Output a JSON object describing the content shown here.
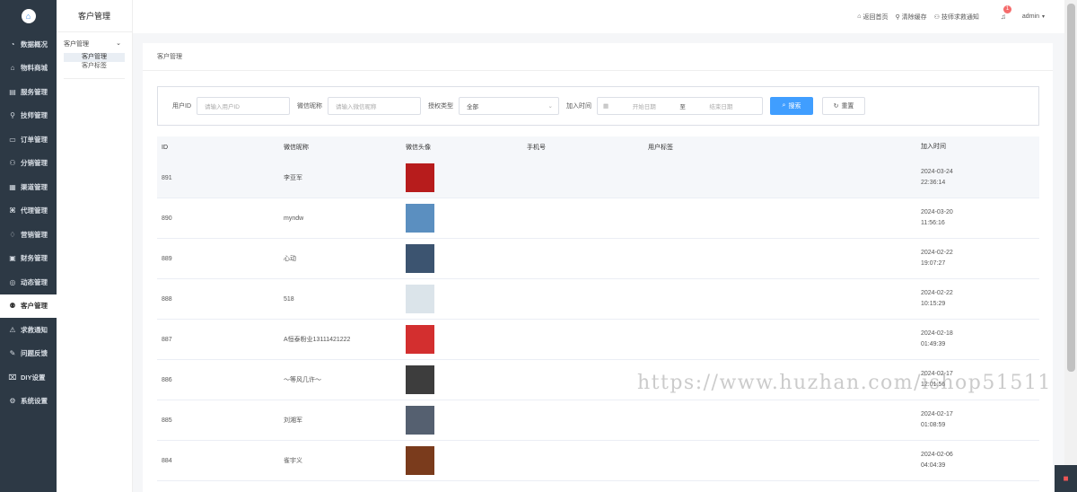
{
  "sidebar": {
    "logo_icon": "house-icon",
    "items": [
      {
        "label": "数据概况",
        "icon": "◔"
      },
      {
        "label": "物料商城",
        "icon": "⌂"
      },
      {
        "label": "服务管理",
        "icon": "▤"
      },
      {
        "label": "技师管理",
        "icon": "⚲"
      },
      {
        "label": "订单管理",
        "icon": "▭"
      },
      {
        "label": "分销管理",
        "icon": "⚇"
      },
      {
        "label": "渠道管理",
        "icon": "▦"
      },
      {
        "label": "代理管理",
        "icon": "⌘"
      },
      {
        "label": "营销管理",
        "icon": "♢"
      },
      {
        "label": "财务管理",
        "icon": "▣"
      },
      {
        "label": "动态管理",
        "icon": "◎"
      },
      {
        "label": "客户管理",
        "icon": "⚉"
      },
      {
        "label": "求救通知",
        "icon": "⚠"
      },
      {
        "label": "问题反馈",
        "icon": "✎"
      },
      {
        "label": "DIY设置",
        "icon": "⌧"
      },
      {
        "label": "系统设置",
        "icon": "⚙"
      }
    ]
  },
  "subnav": {
    "title": "客户管理",
    "group": "客户管理",
    "items": [
      "客户管理",
      "客户标签"
    ]
  },
  "topbar": {
    "home": "返回首页",
    "clear": "清除缓存",
    "alert": "技师求救通知",
    "badge": "1",
    "user": "admin"
  },
  "breadcrumb": "客户管理",
  "filters": {
    "user_id_label": "用户ID",
    "user_id_placeholder": "请输入用户ID",
    "nick_label": "微信昵称",
    "nick_placeholder": "请输入微信昵称",
    "auth_label": "授权类型",
    "auth_value": "全部",
    "join_label": "加入时间",
    "start_placeholder": "开始日期",
    "range_sep": "至",
    "end_placeholder": "结束日期",
    "search": "搜索",
    "reset": "重置"
  },
  "table": {
    "headers": [
      "ID",
      "微信昵称",
      "微信头像",
      "手机号",
      "用户标签",
      "加入时间"
    ],
    "rows": [
      {
        "id": "891",
        "nick": "李亚军",
        "date": "2024-03-24",
        "time": "22:36:14",
        "avatar": "#b71c1c"
      },
      {
        "id": "890",
        "nick": "myndw",
        "date": "2024-03-20",
        "time": "11:56:16",
        "avatar": "#5b8fc0"
      },
      {
        "id": "889",
        "nick": "心动",
        "date": "2024-02-22",
        "time": "19:07:27",
        "avatar": "#3c5470"
      },
      {
        "id": "888",
        "nick": "518",
        "date": "2024-02-22",
        "time": "10:15:29",
        "avatar": "#dbe4ea"
      },
      {
        "id": "887",
        "nick": "A恒泰粉业13111421222",
        "date": "2024-02-18",
        "time": "01:49:39",
        "avatar": "#d32f2f"
      },
      {
        "id": "886",
        "nick": "～等风几许～",
        "date": "2024-02-17",
        "time": "12:01:56",
        "avatar": "#3d3d3d"
      },
      {
        "id": "885",
        "nick": "刘湘军",
        "date": "2024-02-17",
        "time": "01:08:59",
        "avatar": "#556070"
      },
      {
        "id": "884",
        "nick": "雀宇义",
        "date": "2024-02-06",
        "time": "04:04:39",
        "avatar": "#7a3b1c"
      }
    ]
  },
  "watermark": "https://www.huzhan.com/ishop51511"
}
